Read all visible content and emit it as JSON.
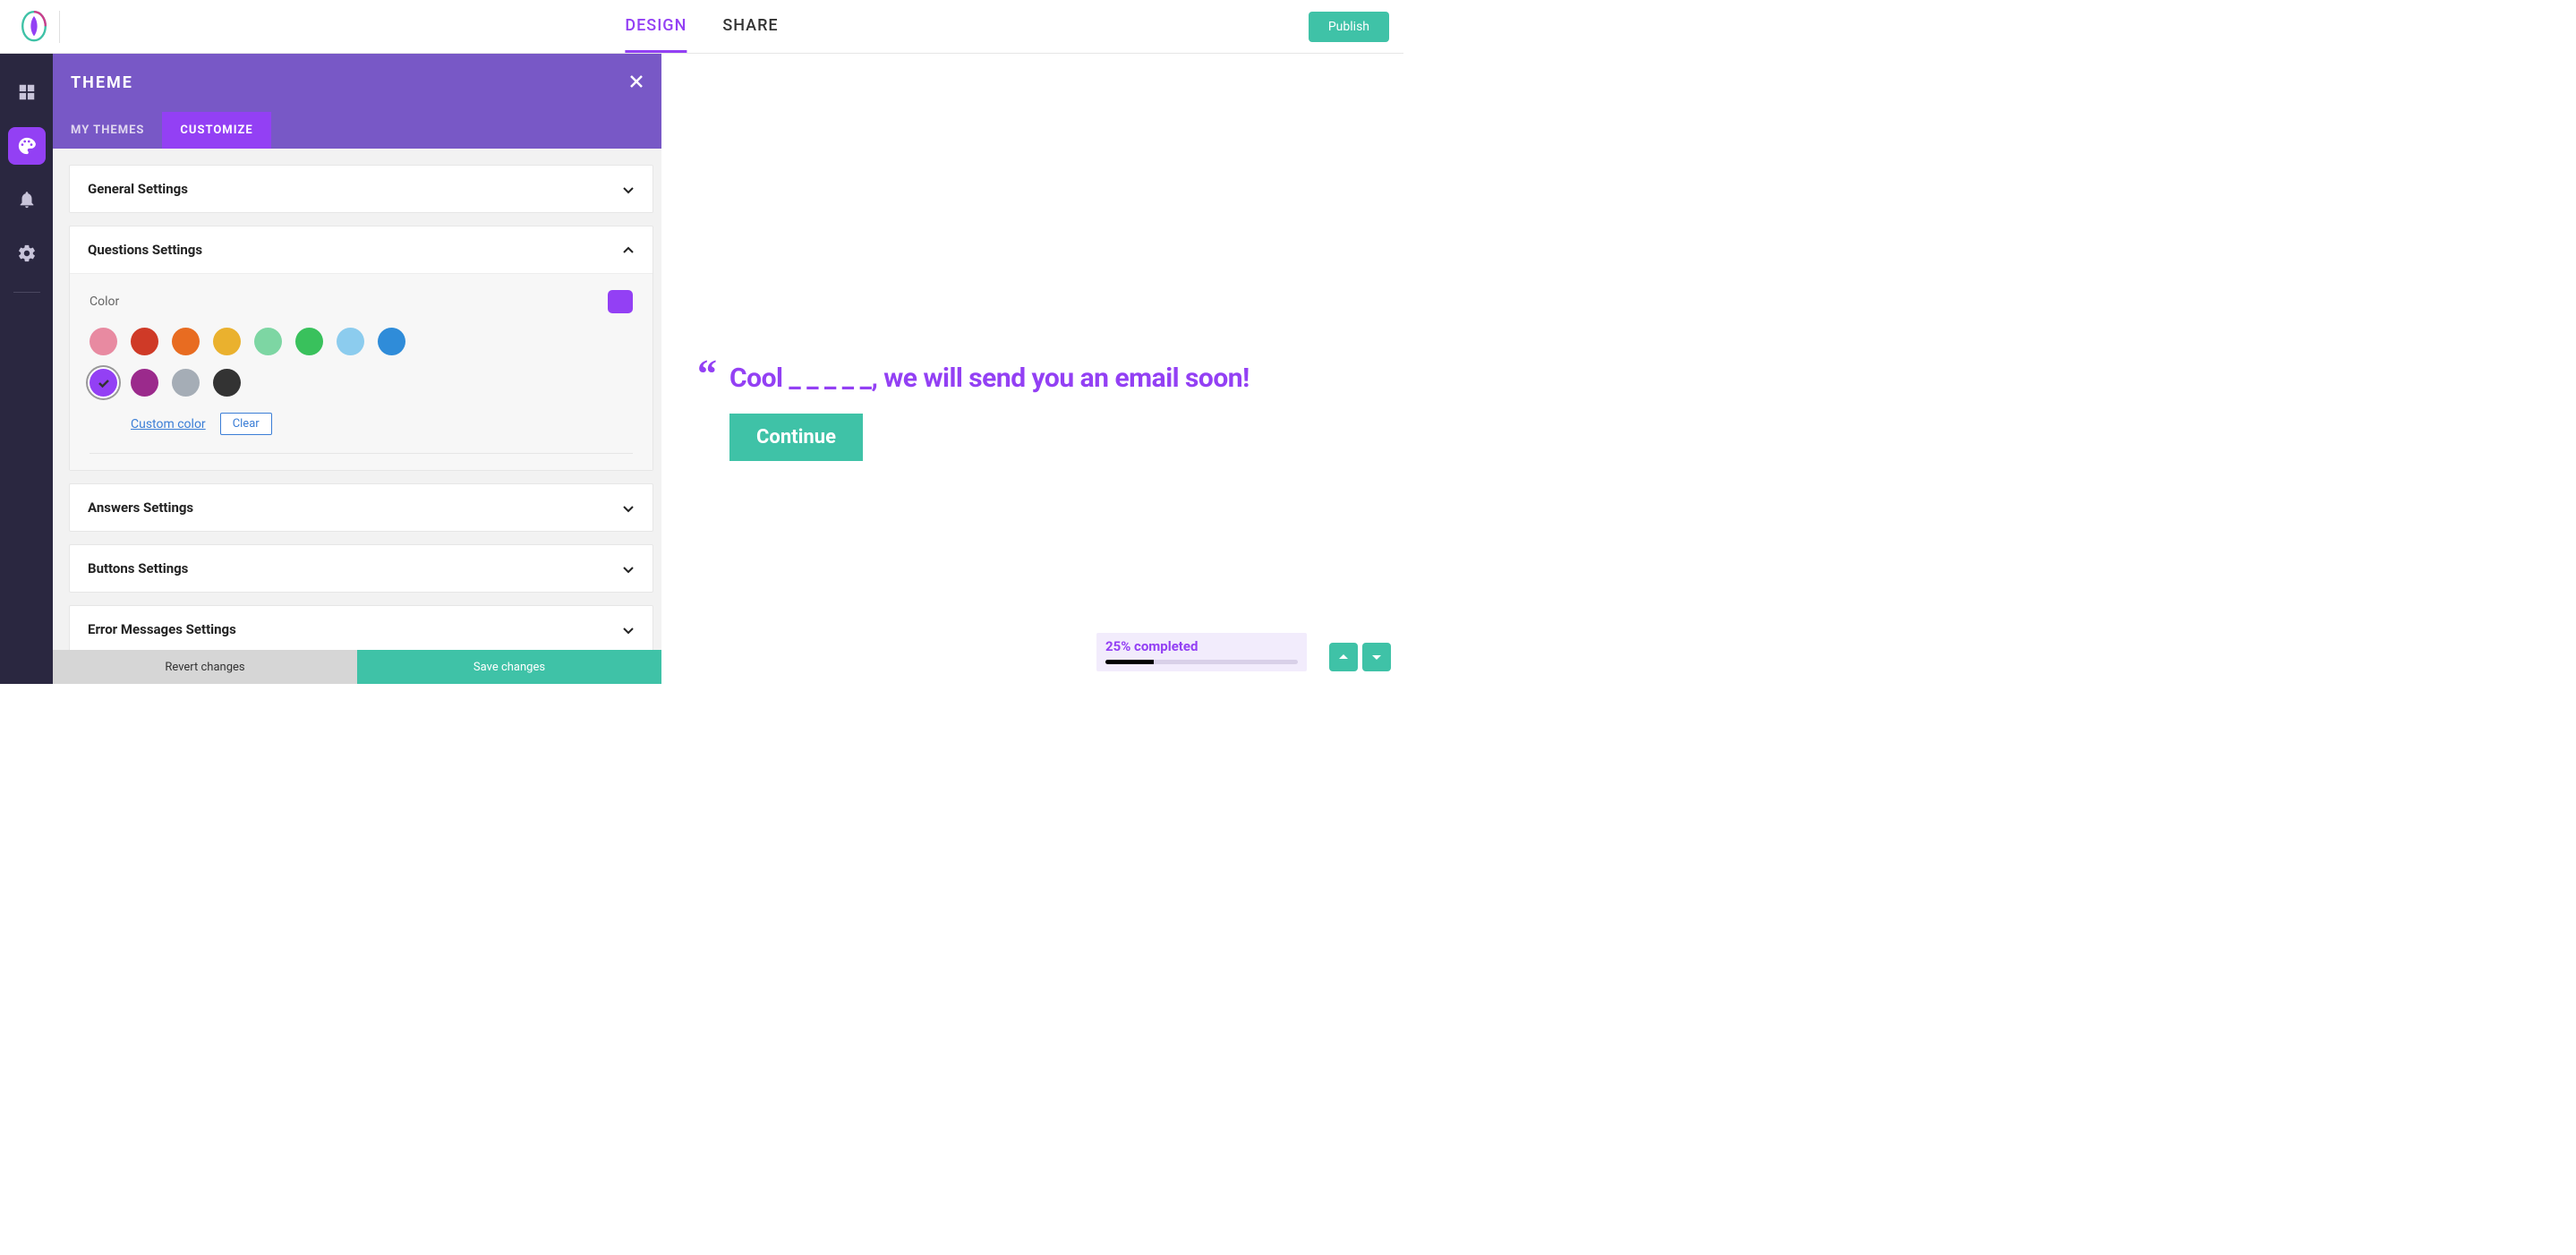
{
  "top": {
    "tabs": [
      "DESIGN",
      "SHARE"
    ],
    "active_tab": 0,
    "publish_label": "Publish"
  },
  "left_nav": {
    "items": [
      "dashboard",
      "palette",
      "notifications",
      "settings"
    ],
    "active_index": 1
  },
  "panel": {
    "title": "THEME",
    "tabs": [
      "MY THEMES",
      "CUSTOMIZE"
    ],
    "active_tab": 1,
    "sections": {
      "general": {
        "title": "General Settings",
        "expanded": false
      },
      "questions": {
        "title": "Questions Settings",
        "expanded": true
      },
      "answers": {
        "title": "Answers Settings",
        "expanded": false
      },
      "buttons": {
        "title": "Buttons Settings",
        "expanded": false
      },
      "errors": {
        "title": "Error Messages Settings",
        "expanded": false
      }
    },
    "color_label": "Color",
    "selected_color": "#9340f4",
    "swatches": [
      "#e88aa1",
      "#cf3a27",
      "#e86c21",
      "#eab12e",
      "#7dd6a3",
      "#39c15c",
      "#8cccee",
      "#2f8cd9",
      "#9340f4",
      "#9b2a8c",
      "#a5adb6",
      "#333333"
    ],
    "selected_swatch_index": 8,
    "custom_color_label": "Custom color",
    "clear_label": "Clear",
    "footer": {
      "revert": "Revert changes",
      "save": "Save changes"
    }
  },
  "preview": {
    "heading": "Cool _ _ _ _ _, we will send you an email soon!",
    "continue_label": "Continue",
    "progress_label": "25% completed",
    "progress_pct": 25
  }
}
